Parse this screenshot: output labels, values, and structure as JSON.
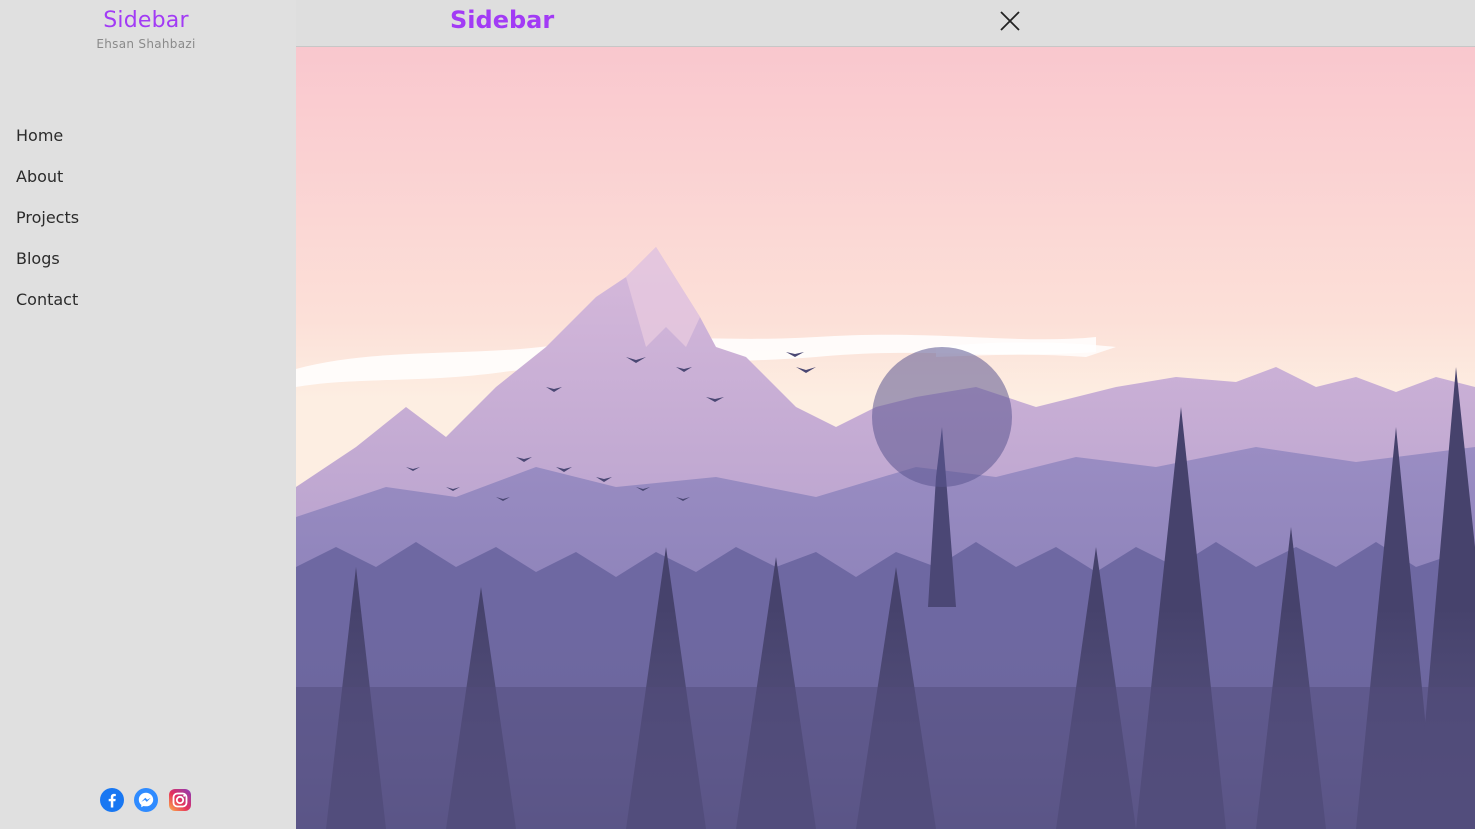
{
  "sidebar": {
    "title": "Sidebar",
    "subtitle": "Ehsan Shahbazi",
    "items": [
      {
        "label": "Home"
      },
      {
        "label": "About"
      },
      {
        "label": "Projects"
      },
      {
        "label": "Blogs"
      },
      {
        "label": "Contact"
      }
    ],
    "social": [
      "facebook-icon",
      "messenger-icon",
      "instagram-icon"
    ]
  },
  "header": {
    "title": "Sidebar",
    "close_icon": "close-icon"
  },
  "colors": {
    "accent": "#a23bf5",
    "sidebar_bg": "#e0e0e0",
    "sky_top": "#f9c9cf",
    "mountain": "#a996c9",
    "forest": "#4a4670"
  }
}
